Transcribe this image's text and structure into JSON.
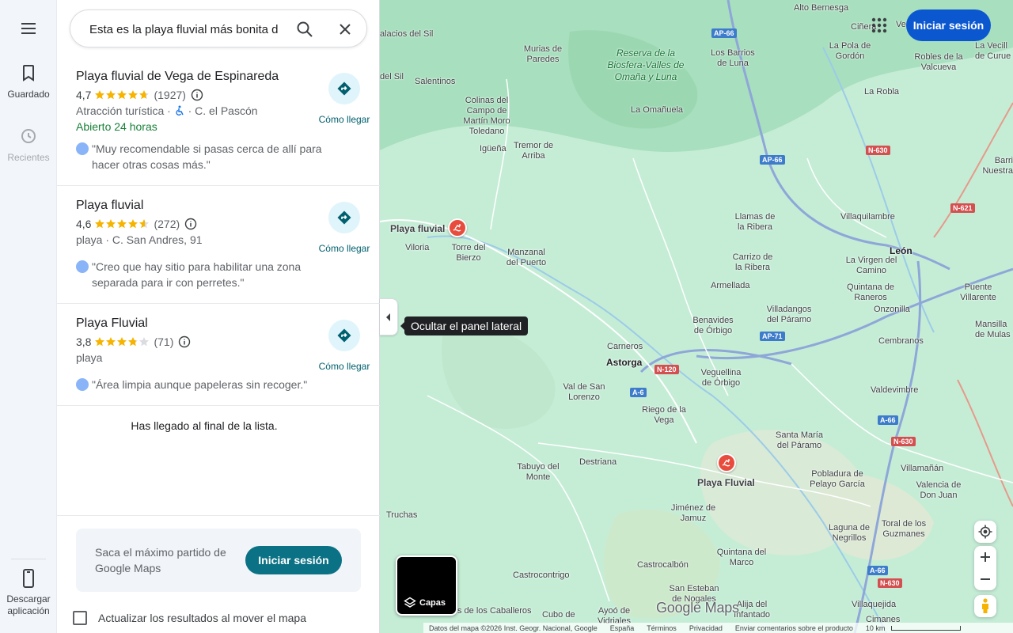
{
  "rail": {
    "saved_label": "Guardado",
    "recent_label": "Recientes",
    "download_label": "Descargar aplicación"
  },
  "search": {
    "query": "Esta es la playa fluvial más bonita d"
  },
  "results": [
    {
      "title": "Playa fluvial de Vega de Espinareda",
      "rating": "4,7",
      "stars": 4.7,
      "reviews": "(1927)",
      "category": "Atracción turística",
      "address": "C. el Pascón",
      "accessible": true,
      "open": "Abierto 24 horas",
      "review": "\"Muy recomendable si pasas cerca de allí para hacer otras cosas más.\"",
      "directions": "Cómo llegar"
    },
    {
      "title": "Playa fluvial",
      "rating": "4,6",
      "stars": 4.6,
      "reviews": "(272)",
      "meta": "playa · C. San Andres, 91",
      "review": "\"Creo que hay sitio para habilitar una zona separada para ir con perretes.\"",
      "directions": "Cómo llegar"
    },
    {
      "title": "Playa Fluvial",
      "rating": "3,8",
      "stars": 3.8,
      "reviews": "(71)",
      "meta": "playa",
      "review": "\"Área limpia aunque papeleras sin recoger.\"",
      "directions": "Cómo llegar"
    }
  ],
  "end_of_list": "Has llegado al final de la lista.",
  "promo": {
    "text": "Saca el máximo partido de Google Maps",
    "button": "Iniciar sesión"
  },
  "update_checkbox": "Actualizar los resultados al mover el mapa",
  "panel_toggle_tooltip": "Ocultar el panel lateral",
  "top_signin": "Iniciar sesión",
  "layers_label": "Capas",
  "map_brand": "Google Maps",
  "attribution": {
    "data": "Datos del mapa ©2026 Inst. Geogr. Nacional, Google",
    "country": "España",
    "terms": "Términos",
    "privacy": "Privacidad",
    "feedback": "Enviar comentarios sobre el producto",
    "scale": "10 km"
  },
  "map_labels": {
    "alto_bernesga": "Alto Bernesga",
    "palacios_sil": "alacios del Sil",
    "murias": "Murias de Paredes",
    "reserva": "Reserva de la Biosfera-Valles de Omaña y Luna",
    "barrios_luna": "Los Barrios de Luna",
    "pola_gordon": "La Pola de Gordón",
    "robles": "Robles de la Valcueva",
    "vecilla": "La Vecill de Curue",
    "cinera": "Ciñera",
    "ve": "Ve",
    "del_sil": "del Sil",
    "salentinos": "Salentinos",
    "colinas": "Colinas del Campo de Martín Moro Toledano",
    "omanuela": "La Omañuela",
    "robla": "La Robla",
    "iguena": "Igüeña",
    "tremor": "Tremor de Arriba",
    "barri": "Barri Nuestra",
    "llamas": "Llamas de la Ribera",
    "villaquilambre": "Villaquilambre",
    "playa_fluvial_1": "Playa fluvial",
    "viloria": "Viloria",
    "torre": "Torre del Bierzo",
    "manzanal": "Manzanal del Puerto",
    "carrizo": "Carrizo de la Ribera",
    "leon": "León",
    "virgen": "La Virgen del Camino",
    "armellada": "Armellada",
    "quintana_raneros": "Quintana de Raneros",
    "puente_villarente": "Puente Villarente",
    "villadangos": "Villadangos del Páramo",
    "onzonilla": "Onzonilla",
    "benavides": "Benavides de Órbigo",
    "mansilla": "Mansilla de Mulas",
    "carneros": "Carneros",
    "cembranos": "Cembranos",
    "astorga": "Astorga",
    "veguellina": "Veguellina de Órbigo",
    "val_san_lorenzo": "Val de San Lorenzo",
    "valdevimbre": "Valdevimbre",
    "riego": "Riego de la Vega",
    "santa_maria": "Santa María del Páramo",
    "destriana": "Destriana",
    "tabuyo": "Tabuyo del Monte",
    "playa_fluvial_2": "Playa Fluvial",
    "villamanan": "Villamañán",
    "pobladura": "Pobladura de Pelayo García",
    "valencia": "Valencia de Don Juan",
    "truchas": "Truchas",
    "jimenez": "Jiménez de Jamuz",
    "laguna": "Laguna de Negrillos",
    "toral": "Toral de los Guzmanes",
    "quintana_marco": "Quintana del Marco",
    "castrocontrigo": "Castrocontrigo",
    "castrocalbon": "Castrocalbón",
    "san_esteban": "San Esteban de Nogales",
    "alija": "Alija del Infantado",
    "villaquejida": "Villaquejida",
    "cabreros": "s de los Caballeros",
    "cubo": "Cubo de",
    "ayoo": "Ayoó de Vidriales",
    "cimanes": "Cimanes"
  },
  "road_shields": {
    "ap66a": "AP-66",
    "ap66b": "AP-66",
    "n630a": "N-630",
    "n621": "N-621",
    "ap71": "AP-71",
    "n120": "N-120",
    "a6": "A-6",
    "a66a": "A-66",
    "n630b": "N-630",
    "a66b": "A-66",
    "n630c": "N-630"
  },
  "colors": {
    "accent": "#0b57d0",
    "teal": "#0b7285",
    "open_green": "#188038",
    "star": "#f6b400",
    "pin": "#e74c3c"
  }
}
